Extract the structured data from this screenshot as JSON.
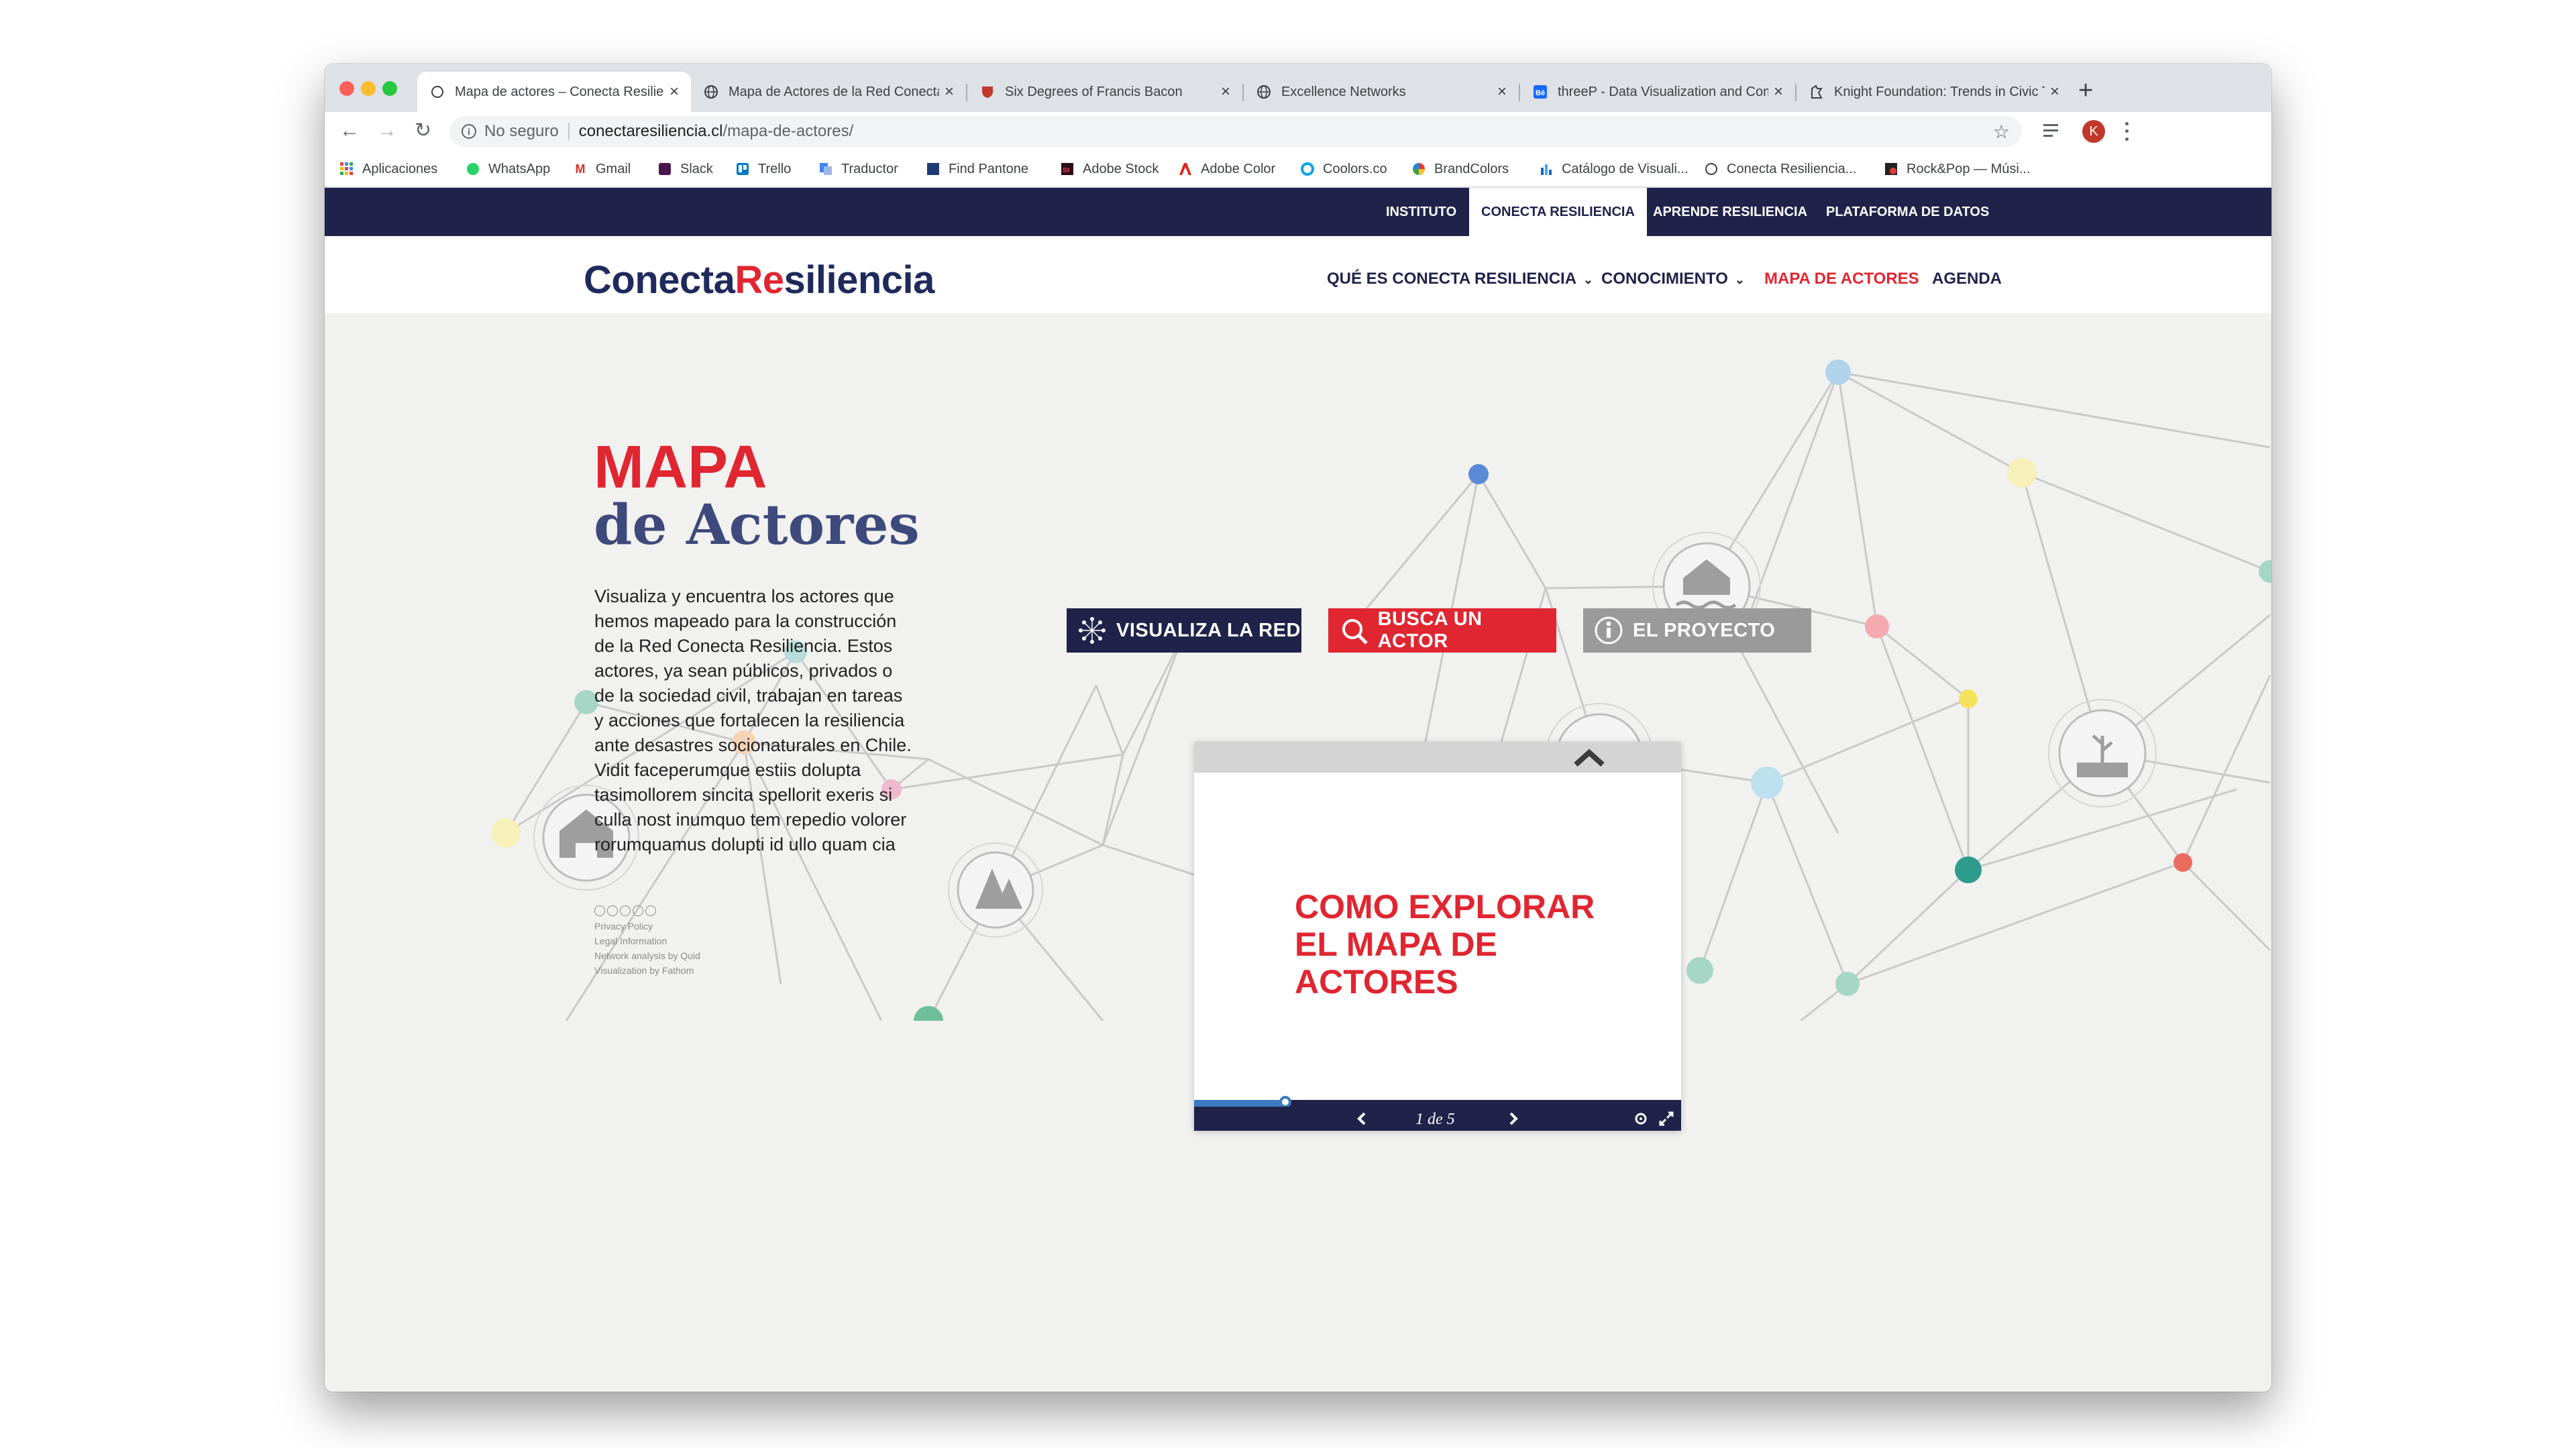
{
  "browser": {
    "tabs": [
      {
        "title": "Mapa de actores – Conecta Resiliencia",
        "active": true,
        "icon": "loading-circle-icon"
      },
      {
        "title": "Mapa de Actores de la Red Conecta Resiliencia",
        "active": false,
        "icon": "globe-icon"
      },
      {
        "title": "Six Degrees of Francis Bacon",
        "active": false,
        "icon": "crest-icon"
      },
      {
        "title": "Excellence Networks",
        "active": false,
        "icon": "globe-icon"
      },
      {
        "title": "threeP - Data Visualization and Comm",
        "active": false,
        "icon": "behance-icon"
      },
      {
        "title": "Knight Foundation: Trends in Civic Tech",
        "active": false,
        "icon": "knight-icon"
      }
    ],
    "new_tab": "+",
    "security": "No seguro",
    "url_domain": "conectaresiliencia.cl",
    "url_path": "/mapa-de-actores/",
    "avatar_initial": "K",
    "bookmarks": [
      {
        "label": "Aplicaciones",
        "icon": "apps-grid-icon"
      },
      {
        "label": "WhatsApp",
        "icon": "whatsapp-icon"
      },
      {
        "label": "Gmail",
        "icon": "gmail-icon"
      },
      {
        "label": "Slack",
        "icon": "slack-icon"
      },
      {
        "label": "Trello",
        "icon": "trello-icon"
      },
      {
        "label": "Traductor",
        "icon": "translate-icon"
      },
      {
        "label": "Find Pantone",
        "icon": "pantone-icon"
      },
      {
        "label": "Adobe Stock",
        "icon": "adobe-stock-icon"
      },
      {
        "label": "Adobe Color",
        "icon": "adobe-icon"
      },
      {
        "label": "Coolors.co",
        "icon": "coolors-icon"
      },
      {
        "label": "BrandColors",
        "icon": "brandcolors-icon"
      },
      {
        "label": "Catálogo de Visuali...",
        "icon": "bar-chart-icon"
      },
      {
        "label": "Conecta Resiliencia...",
        "icon": "circle-icon"
      },
      {
        "label": "Rock&Pop — Músi...",
        "icon": "rockpop-icon"
      }
    ]
  },
  "site": {
    "topnav": [
      {
        "label": "INSTITUTO",
        "active": false
      },
      {
        "label": "CONECTA RESILIENCIA",
        "active": true
      },
      {
        "label": "APRENDE RESILIENCIA",
        "active": false
      },
      {
        "label": "PLATAFORMA DE DATOS",
        "active": false
      }
    ],
    "logo": {
      "part1": "Conecta",
      "part2": "Re",
      "part3": "siliencia"
    },
    "mainnav": [
      {
        "label": "QUÉ ES CONECTA RESILIENCIA",
        "dropdown": true,
        "active": false
      },
      {
        "label": "CONOCIMIENTO",
        "dropdown": true,
        "active": false
      },
      {
        "label": "MAPA DE ACTORES",
        "dropdown": false,
        "active": true
      },
      {
        "label": "AGENDA",
        "dropdown": false,
        "active": false
      }
    ],
    "dropdown_glyph": "⌄"
  },
  "hero": {
    "title_line1": "MAPA",
    "title_line2": "de Actores",
    "intro_lines": [
      "Visualiza y encuentra los actores que",
      "hemos mapeado para la construcción",
      "de la Red Conecta Resiliencia. Estos",
      "actores, ya sean públicos, privados o",
      "de la sociedad civil, trabajan en tareas",
      "y acciones que fortalecen la resiliencia",
      "ante desastres socionaturales en Chile.",
      "Vidit faceperumque estiis dolupta",
      "tasimollorem sincita spellorit exeris si",
      "culla nost inumquo tem repedio volorer",
      "rorumquamus dolupti id ullo quam cia"
    ],
    "footer_links": [
      "Privacy Policy",
      "Legal Information",
      "Network analysis by Quid",
      "Visualization by Fathom"
    ]
  },
  "actions": {
    "visualiza": "VISUALIZA LA RED",
    "busca": "BUSCA UN ACTOR",
    "proyecto": "EL PROYECTO"
  },
  "modal": {
    "heading_lines": [
      "COMO EXPLORAR",
      "EL MAPA DE",
      "ACTORES"
    ],
    "pager": "1 de 5",
    "current": 1,
    "total": 5
  },
  "colors": {
    "navy": "#1f234a",
    "red": "#e02631",
    "gray_button": "#9a9a9a",
    "progress": "#3a7bbf"
  }
}
